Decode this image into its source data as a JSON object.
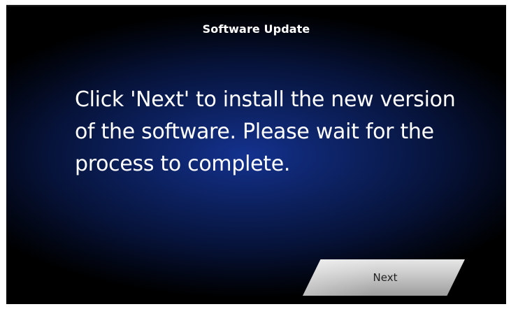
{
  "dialog": {
    "title": "Software Update",
    "message": "Click 'Next' to install the new version of the software. Please wait for the process to complete.",
    "next_label": "Next"
  },
  "colors": {
    "background": "#000000",
    "glow": "#14328f",
    "text": "#ffffff",
    "button": "#c8c8c8",
    "button_text": "#222222"
  }
}
